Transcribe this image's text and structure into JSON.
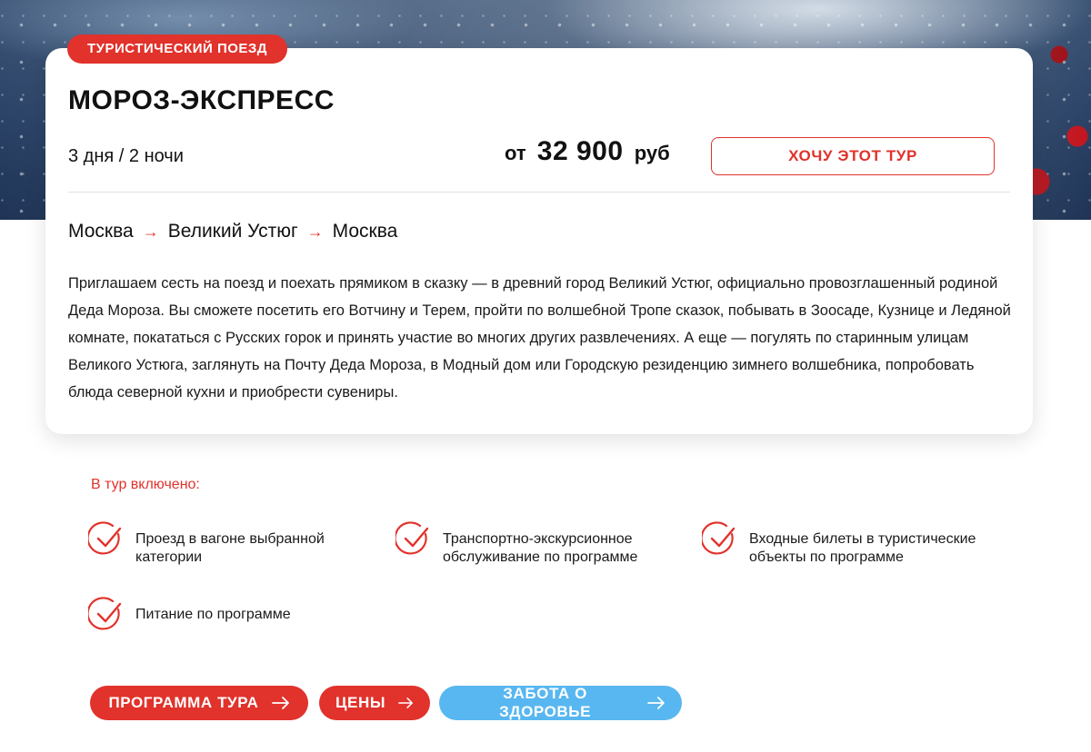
{
  "tour": {
    "badge": "ТУРИСТИЧЕСКИЙ ПОЕЗД",
    "title": "МОРОЗ-ЭКСПРЕСС",
    "duration": "3 дня / 2 ночи",
    "price_prefix": "от",
    "price_amount": "32 900",
    "price_currency": "руб",
    "cta_label": "ХОЧУ ЭТОТ ТУР",
    "route": [
      "Москва",
      "Великий Устюг",
      "Москва"
    ],
    "route_arrow": "→",
    "description": "Приглашаем сесть на поезд и поехать прямиком в сказку — в древний город Великий Устюг, официально провозглашенный родиной Деда Мороза. Вы сможете посетить его Вотчину и Терем, пройти по волшебной Тропе сказок, побывать в Зоосаде, Кузнице и Ледяной комнате, покататься с Русских горок и принять участие во многих других развлечениях. А еще — погулять по старинным улицам Великого Устюга, заглянуть на Почту Деда Мороза, в Модный дом или Городскую резиденцию зимнего волшебника, попробовать блюда северной кухни и приобрести сувениры."
  },
  "included": {
    "heading": "В тур включено:",
    "items": [
      {
        "label": "Проезд в вагоне выбранной категории",
        "icon": "check-circle-icon"
      },
      {
        "label": "Транспортно-экскурсионное обслуживание по программе",
        "icon": "check-circle-icon"
      },
      {
        "label": "Входные билеты в туристические объекты по программе",
        "icon": "check-circle-icon"
      },
      {
        "label": "Питание по программе",
        "icon": "check-circle-icon"
      }
    ]
  },
  "buttons": {
    "program": "ПРОГРАММА ТУРА",
    "prices": "ЦЕНЫ",
    "health": "ЗАБОТА О ЗДОРОВЬЕ"
  },
  "colors": {
    "accent_red": "#e1322b",
    "accent_blue": "#58b7f0"
  }
}
